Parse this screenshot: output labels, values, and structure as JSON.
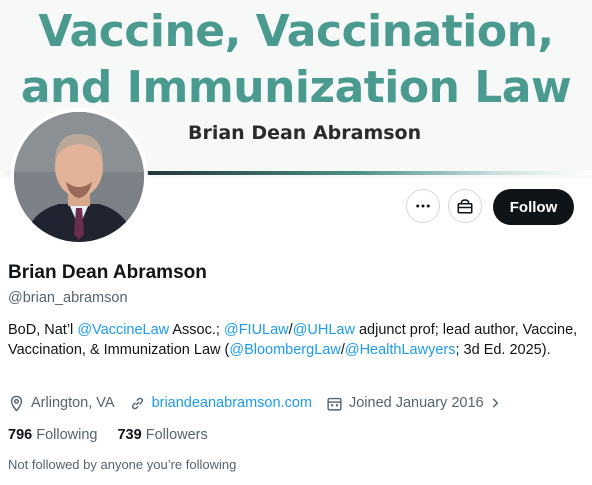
{
  "banner": {
    "title_line1": "Vaccine, Vaccination,",
    "title_line2": "and Immunization Law",
    "author": "Brian Dean Abramson",
    "title_color": "#4a9a8f"
  },
  "actions": {
    "more_icon": "more-icon",
    "subscribe_icon": "gift-icon",
    "follow_label": "Follow"
  },
  "profile": {
    "name": "Brian Dean Abramson",
    "handle": "@brian_abramson",
    "bio": {
      "t1": "BoD, Nat’l ",
      "m1": "@VaccineLaw",
      "t2": " Assoc.; ",
      "m2": "@FIULaw",
      "t3": "/",
      "m3": "@UHLaw",
      "t4": " adjunct prof; lead author, Vaccine, Vaccination, & Immunization Law (",
      "m4": "@BloombergLaw",
      "t5": "/",
      "m5": "@HealthLawyers",
      "t6": "; 3d Ed. 2025)."
    },
    "location": "Arlington, VA",
    "website": "briandeanabramson.com",
    "joined": "Joined January 2016",
    "following_count": "796",
    "following_label": "Following",
    "followers_count": "739",
    "followers_label": "Followers",
    "followed_note": "Not followed by anyone you’re following"
  },
  "colors": {
    "link": "#1d9bf0",
    "muted": "#536471",
    "text": "#0f1419"
  }
}
